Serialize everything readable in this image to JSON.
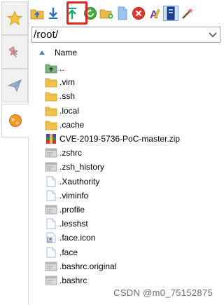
{
  "tabs": [
    {
      "icon": "star-icon",
      "active": false
    },
    {
      "icon": "pin-icon",
      "active": false
    },
    {
      "icon": "send-icon",
      "active": false
    },
    {
      "icon": "globe-icon",
      "active": true
    }
  ],
  "toolbar": {
    "buttons": [
      {
        "icon": "folder-up-icon"
      },
      {
        "icon": "download-icon"
      },
      {
        "icon": "upload-icon"
      },
      {
        "icon": "refresh-icon"
      },
      {
        "icon": "new-folder-icon"
      },
      {
        "icon": "new-file-icon"
      },
      {
        "icon": "delete-icon"
      },
      {
        "icon": "rename-icon"
      },
      {
        "icon": "properties-icon"
      },
      {
        "icon": "magic-wand-icon"
      }
    ],
    "highlight_color": "#e0241f"
  },
  "path": {
    "value": "/root/"
  },
  "list_header": {
    "name_label": "Name"
  },
  "files": [
    {
      "name": "..",
      "type": "parent"
    },
    {
      "name": ".vim",
      "type": "folder"
    },
    {
      "name": ".ssh",
      "type": "folder"
    },
    {
      "name": ".local",
      "type": "folder"
    },
    {
      "name": ".cache",
      "type": "folder"
    },
    {
      "name": "CVE-2019-5736-PoC-master.zip",
      "type": "zip"
    },
    {
      "name": ".zshrc",
      "type": "script"
    },
    {
      "name": ".zsh_history",
      "type": "script"
    },
    {
      "name": ".Xauthority",
      "type": "file"
    },
    {
      "name": ".viminfo",
      "type": "file"
    },
    {
      "name": ".profile",
      "type": "script"
    },
    {
      "name": ".lesshst",
      "type": "file"
    },
    {
      "name": ".face.icon",
      "type": "shortcut"
    },
    {
      "name": ".face",
      "type": "file"
    },
    {
      "name": ".bashrc.original",
      "type": "script"
    },
    {
      "name": ".bashrc",
      "type": "script"
    }
  ],
  "watermark": "CSDN @m0_75152875"
}
